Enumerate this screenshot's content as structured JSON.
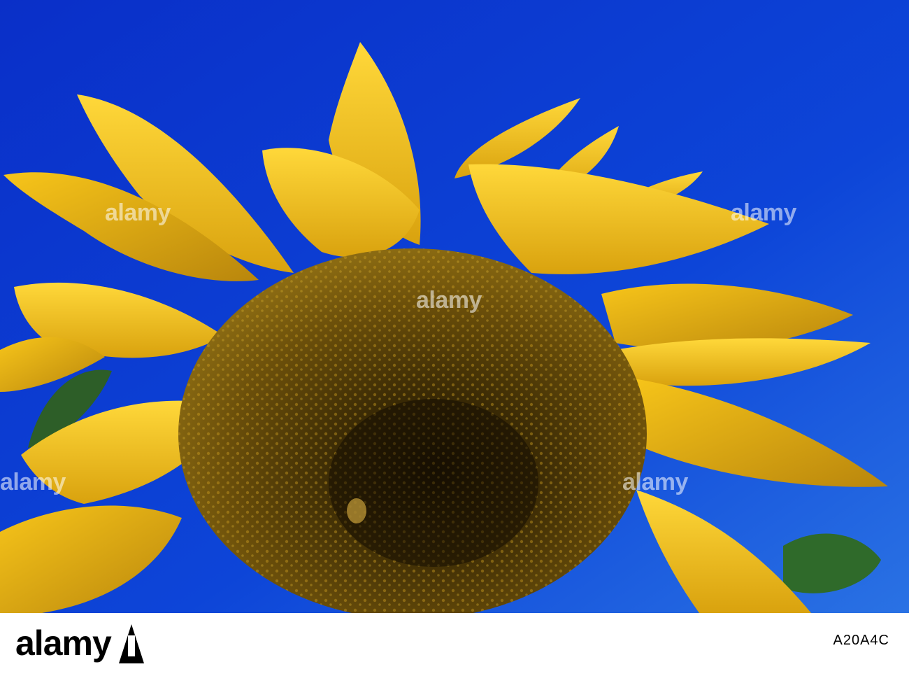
{
  "image": {
    "subject": "Sunflower head against blue sky",
    "colors": {
      "sky": "#0b3fd6",
      "petal": "#f4c21c",
      "disk": "#5a4408",
      "leaf": "#2f6a2a"
    }
  },
  "watermark": {
    "text": "alamy"
  },
  "footer": {
    "brand": "alamy",
    "stock_text": "A20A4C"
  }
}
